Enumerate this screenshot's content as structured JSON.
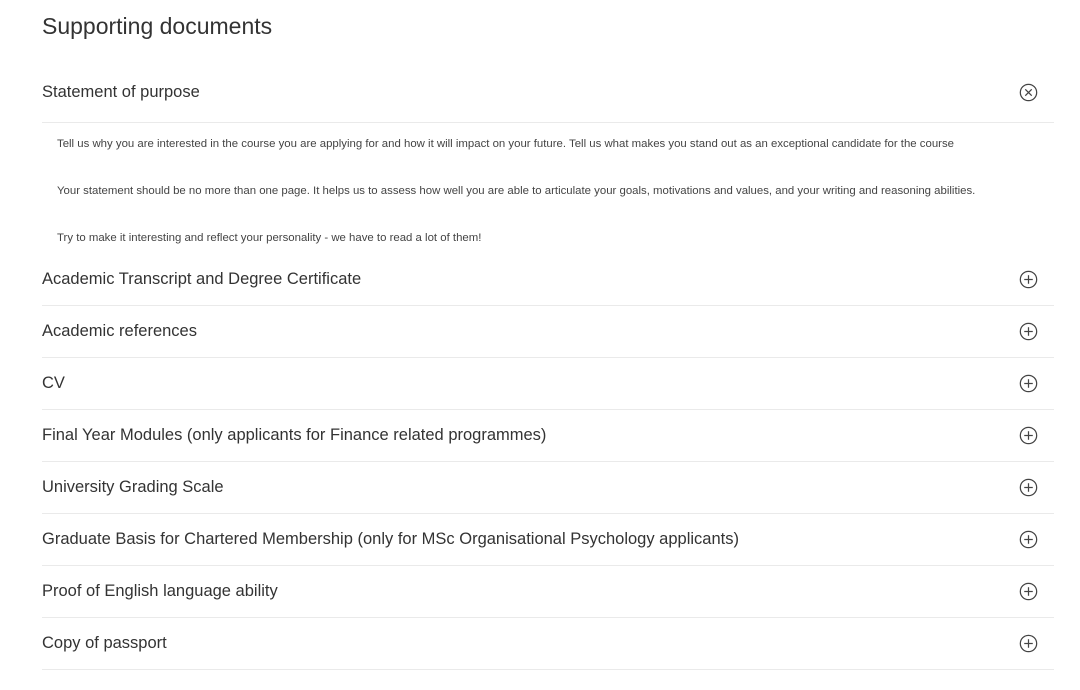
{
  "page": {
    "title": "Supporting documents"
  },
  "accordion": {
    "open_item": {
      "title": "Statement of purpose",
      "state": "expanded",
      "icon": "close-circle-icon",
      "paragraphs": [
        "Tell us why you are interested in the course you are applying for and how it will impact on your future. Tell us what makes you stand out as an exceptional candidate for the course",
        "Your statement should be no more than one page. It helps us to assess how well you are able to articulate your goals, motivations and values, and your writing and reasoning abilities.",
        "Try to make it interesting and reflect your personality - we have to read a lot of them!"
      ]
    },
    "items": [
      {
        "title": "Academic Transcript and Degree Certificate",
        "state": "collapsed",
        "icon": "plus-circle-icon"
      },
      {
        "title": "Academic references",
        "state": "collapsed",
        "icon": "plus-circle-icon"
      },
      {
        "title": "CV",
        "state": "collapsed",
        "icon": "plus-circle-icon"
      },
      {
        "title": "Final Year Modules (only applicants for Finance related programmes)",
        "state": "collapsed",
        "icon": "plus-circle-icon"
      },
      {
        "title": "University Grading Scale",
        "state": "collapsed",
        "icon": "plus-circle-icon"
      },
      {
        "title": "Graduate Basis for Chartered Membership (only for MSc Organisational Psychology applicants)",
        "state": "collapsed",
        "icon": "plus-circle-icon"
      },
      {
        "title": "Proof of English language ability",
        "state": "collapsed",
        "icon": "plus-circle-icon"
      },
      {
        "title": "Copy of passport",
        "state": "collapsed",
        "icon": "plus-circle-icon"
      }
    ]
  },
  "colors": {
    "text": "#333333",
    "divider": "#eaeaea",
    "icon": "#444444"
  }
}
